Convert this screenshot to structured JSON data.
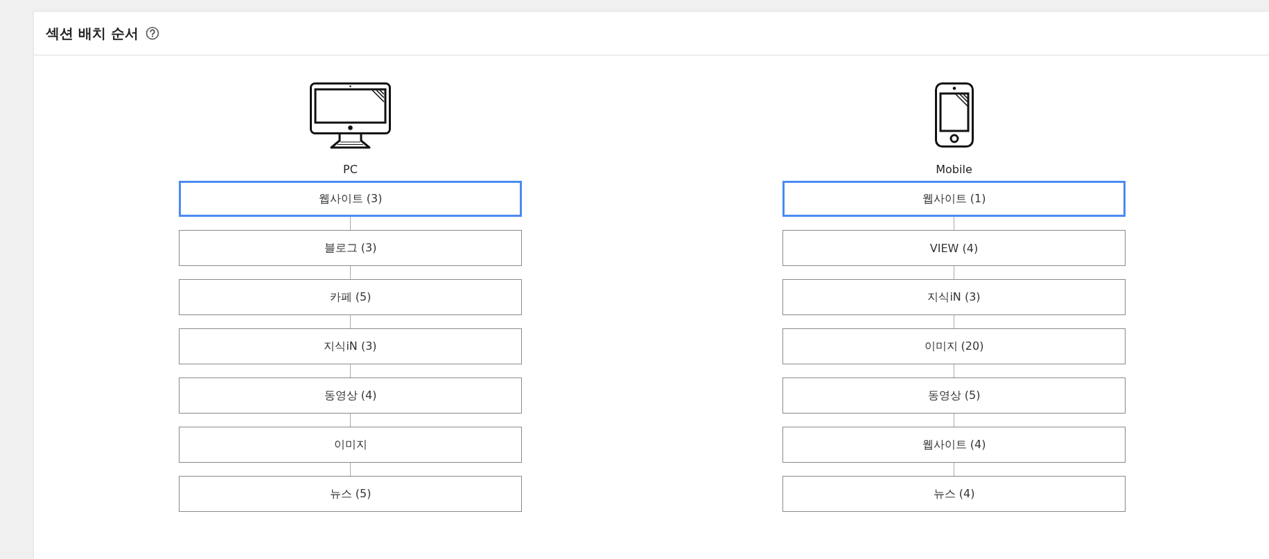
{
  "section": {
    "title": "섹션 배치 순서"
  },
  "columns": [
    {
      "kind": "pc",
      "label": "PC",
      "items": [
        {
          "label": "웹사이트 (3)",
          "selected": true
        },
        {
          "label": "블로그 (3)",
          "selected": false
        },
        {
          "label": "카페 (5)",
          "selected": false
        },
        {
          "label": "지식iN (3)",
          "selected": false
        },
        {
          "label": "동영상 (4)",
          "selected": false
        },
        {
          "label": "이미지",
          "selected": false
        },
        {
          "label": "뉴스 (5)",
          "selected": false
        }
      ]
    },
    {
      "kind": "mobile",
      "label": "Mobile",
      "items": [
        {
          "label": "웹사이트 (1)",
          "selected": true
        },
        {
          "label": "VIEW (4)",
          "selected": false
        },
        {
          "label": "지식iN (3)",
          "selected": false
        },
        {
          "label": "이미지 (20)",
          "selected": false
        },
        {
          "label": "동영상 (5)",
          "selected": false
        },
        {
          "label": "웹사이트 (4)",
          "selected": false
        },
        {
          "label": "뉴스 (4)",
          "selected": false
        }
      ]
    }
  ]
}
